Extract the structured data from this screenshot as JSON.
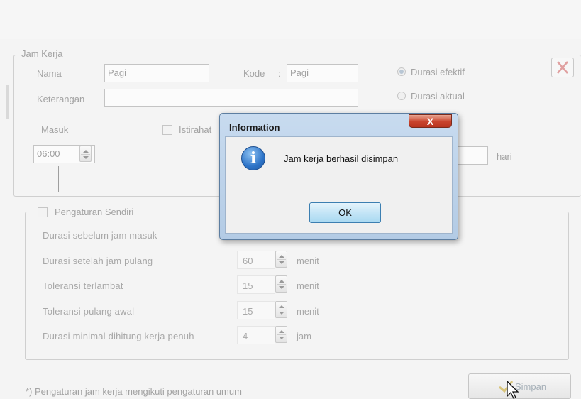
{
  "jam_kerja": {
    "legend": "Jam Kerja",
    "nama_label": "Nama",
    "nama_value": "Pagi",
    "kode_label": "Kode",
    "kode_sep": ":",
    "kode_value": "Pagi",
    "keterangan_label": "Keterangan",
    "keterangan_value": "",
    "durasi_efektif": "Durasi efektif",
    "durasi_aktual": "Durasi aktual",
    "masuk_label": "Masuk",
    "masuk_value": "06:00",
    "istirahat_label": "Istirahat",
    "hari_label": "hari"
  },
  "pengaturan_sendiri": {
    "legend": "Pengaturan Sendiri",
    "rows": [
      {
        "label": "Durasi sebelum jam masuk",
        "value": "",
        "unit": ""
      },
      {
        "label": "Durasi setelah jam pulang",
        "value": "60",
        "unit": "menit"
      },
      {
        "label": "Toleransi terlambat",
        "value": "15",
        "unit": "menit"
      },
      {
        "label": "Toleransi pulang awal",
        "value": "15",
        "unit": "menit"
      },
      {
        "label": "Durasi minimal dihitung kerja penuh",
        "value": "4",
        "unit": "jam"
      }
    ]
  },
  "footer": {
    "note": "*) Pengaturan jam kerja mengikuti pengaturan umum",
    "simpan_label": "Simpan"
  },
  "dialog": {
    "title": "Information",
    "message": "Jam kerja berhasil disimpan",
    "ok_label": "OK",
    "close_glyph": "X",
    "icon_glyph": "i"
  },
  "colors": {
    "background": "#f4f4f4",
    "dialog_frame": "#b3cbe5",
    "close_button": "#c9432d",
    "ok_button": "#c4e5f6"
  }
}
